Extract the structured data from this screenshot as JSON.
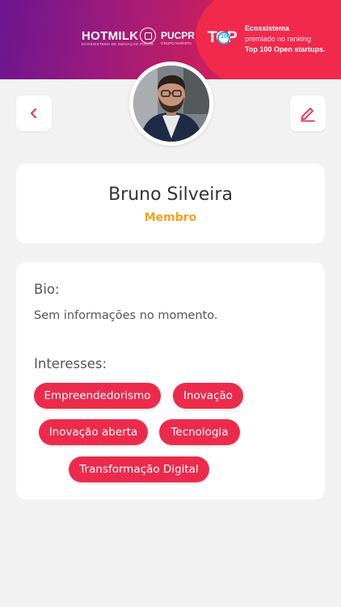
{
  "header": {
    "brand_hotmilk": "HOTMILK",
    "brand_hotmilk_sub": "ECOSSISTEMA DE INOVAÇÃO PUCPR",
    "brand_pucpr": "PUCPR",
    "brand_pucpr_sub": "GRUPO MARISTA",
    "top_logo": "TOP",
    "top_logo_badge": "100",
    "top_line1": "Ecossistema",
    "top_line2": "premiado no ranking",
    "top_line3": "Top 100 Open startups."
  },
  "profile": {
    "name": "Bruno Silveira",
    "role": "Membro"
  },
  "bio": {
    "title": "Bio:",
    "text": "Sem informações no momento."
  },
  "interests": {
    "title": "Interesses:",
    "items": [
      "Empreendedorismo",
      "Inovação",
      "Inovação aberta",
      "Tecnologia",
      "Transformação Digital"
    ]
  },
  "colors": {
    "accent": "#ec2b4c",
    "role": "#f4a21c",
    "banner_start": "#6a1590",
    "banner_end": "#e8254e"
  },
  "icons": {
    "back": "chevron-left-icon",
    "edit": "pencil-icon"
  }
}
